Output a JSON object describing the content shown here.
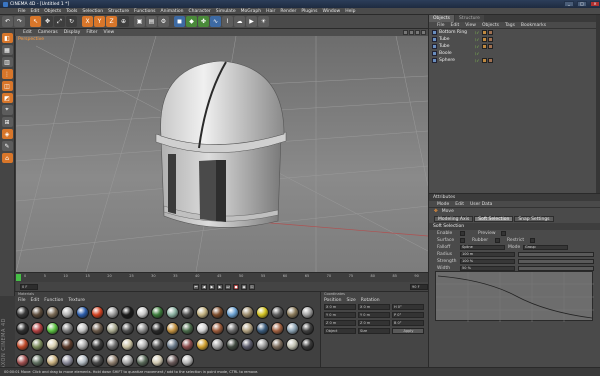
{
  "window": {
    "title": "CINEMA 4D - [Untitled 1 *]",
    "buttons": [
      "_",
      "□",
      "×"
    ]
  },
  "menubar": [
    "File",
    "Edit",
    "Objects",
    "Tools",
    "Selection",
    "Structure",
    "Functions",
    "Animation",
    "Character",
    "Simulate",
    "MoGraph",
    "Hair",
    "Render",
    "Plugins",
    "Window",
    "Help"
  ],
  "toolbar": {
    "icons": [
      "undo-icon",
      "redo-icon",
      "live-select-icon",
      "move-icon",
      "scale-icon",
      "rotate-icon",
      "x-axis-icon",
      "y-axis-icon",
      "z-axis-icon",
      "coordinate-system-icon",
      "render-view-icon",
      "render-picture-viewer-icon",
      "render-settings-icon",
      "cube-icon",
      "subdivision-icon",
      "array-icon",
      "spline-icon",
      "deformer-icon",
      "environment-icon",
      "camera-icon",
      "light-icon"
    ],
    "axis_labels": [
      "X",
      "Y",
      "Z"
    ]
  },
  "viewport": {
    "menu": [
      "Edit",
      "Cameras",
      "Display",
      "Filter",
      "View"
    ],
    "label": "Perspective"
  },
  "timeline": {
    "ticks": [
      "0",
      "5",
      "10",
      "15",
      "20",
      "25",
      "30",
      "35",
      "40",
      "45",
      "50",
      "55",
      "60",
      "65",
      "70",
      "75",
      "80",
      "85",
      "90"
    ],
    "current_frame": "0 F",
    "end_frame": "90 F"
  },
  "object_manager": {
    "tabs": [
      "Objects",
      "Structure"
    ],
    "menu": [
      "File",
      "Edit",
      "View",
      "Objects",
      "Tags",
      "Bookmarks"
    ],
    "objects": [
      {
        "name": "Bottom Ring",
        "color": "#6a8fc0"
      },
      {
        "name": "Tube",
        "color": "#6a8fc0"
      },
      {
        "name": "Tube",
        "color": "#6a8fc0"
      },
      {
        "name": "Boole",
        "color": "#6a8fc0"
      },
      {
        "name": "Sphere",
        "color": "#6a8fc0"
      }
    ]
  },
  "attribute_manager": {
    "title": "Attributes",
    "menu": [
      "Mode",
      "Edit",
      "User Data"
    ],
    "object_name": "Move",
    "tabs": [
      "Modeling Axis",
      "Soft Selection",
      "Snap Settings"
    ],
    "active_tab": "Soft Selection",
    "section": "Soft Selection",
    "enable_label": "Enable",
    "preview_label": "Preview",
    "surface_label": "Surface",
    "rubber_label": "Rubber",
    "restrict_label": "Restrict",
    "falloff_label": "Falloff",
    "falloff_value": "Spline",
    "mode_label": "Mode",
    "mode_value": "Group",
    "radius_label": "Radius",
    "radius_value": "100 m",
    "strength_label": "Strength",
    "strength_value": "100 %",
    "width_label": "Width",
    "width_value": "50 %"
  },
  "material_manager": {
    "title": "Materials",
    "menu": [
      "File",
      "Edit",
      "Function",
      "Texture"
    ],
    "balls": [
      "#3a3a3a",
      "#5a4a3a",
      "#7a6a55",
      "#b0b0b0",
      "#2a5ba8",
      "#d04020",
      "#9a9a9a",
      "#1a1a1a",
      "#c8c8c8",
      "#3a7a3a",
      "#8ab0a0",
      "#4a4a4a",
      "#c0b080",
      "#7a4a2a",
      "#6aa0d0",
      "#9a8a6a",
      "#d0c020",
      "#5a5a5a",
      "#8a7a5a",
      "#a0a0a0",
      "#303030",
      "#b04040",
      "#5ac040",
      "#7a7a7a",
      "#c0c0c0",
      "#6a5a4a",
      "#a8a890",
      "#505050",
      "#8a8a8a",
      "#2a2a2a",
      "#c09040",
      "#4a6a4a",
      "#d0d0d0",
      "#9a5a3a",
      "#6a6a6a",
      "#b0a080",
      "#3a5a7a",
      "#a06040",
      "#8aa0b0",
      "#404040",
      "#c04a2a",
      "#7a8a5a",
      "#d8d0b0",
      "#5a3a2a",
      "#a8a8a8",
      "#3a3a3a",
      "#707070",
      "#c8c0a0",
      "#b0b0b0",
      "#505050",
      "#6a7a8a",
      "#8a4a4a",
      "#d0a030",
      "#a0a0a0",
      "#404a40",
      "#5a5a6a",
      "#9a9a9a",
      "#7a6a5a",
      "#c0c0b0",
      "#3a3a3a",
      "#a05050",
      "#607060",
      "#c8b080",
      "#8a8a9a",
      "#b0b8c0",
      "#4a4a4a",
      "#908070",
      "#a8a8a8",
      "#5a6a5a",
      "#d0c8b0",
      "#6a5a5a",
      "#b8b8b8"
    ]
  },
  "coordinates": {
    "title": "Coordinates",
    "menu": [
      "Position",
      "Size",
      "Rotation"
    ],
    "rows": [
      [
        "X 0 m",
        "X 0 m",
        "H 0°"
      ],
      [
        "Y 0 m",
        "Y 0 m",
        "P 0°"
      ],
      [
        "Z 0 m",
        "Z 0 m",
        "B 0°"
      ]
    ],
    "dropdown1": "Object",
    "dropdown2": "Size",
    "apply_label": "Apply"
  },
  "statusbar": {
    "text": "00:00:01 Move: Click and drag to move elements. Hold down SHIFT to quantize movement / add to the selection in point mode, CTRL to remove."
  },
  "logo": "MAXON CINEMA 4D"
}
